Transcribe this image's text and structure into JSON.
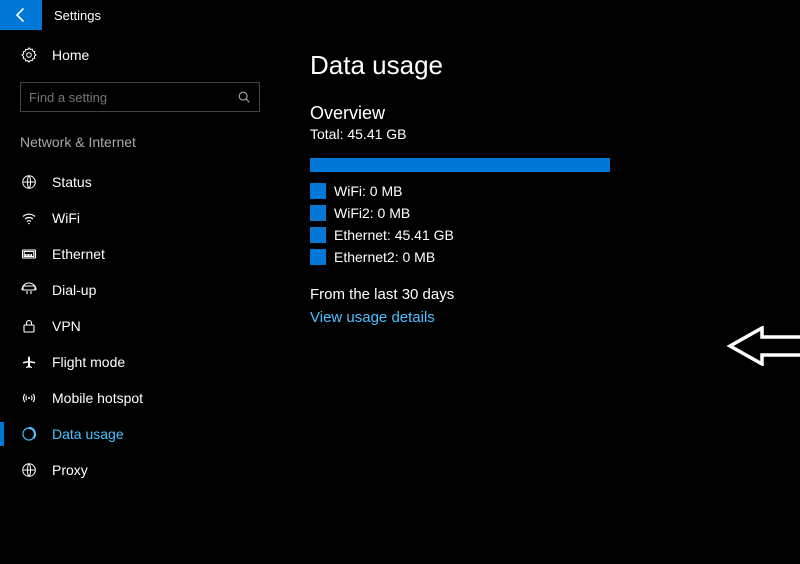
{
  "titlebar": {
    "label": "Settings"
  },
  "sidebar": {
    "home_label": "Home",
    "search_placeholder": "Find a setting",
    "category": "Network & Internet",
    "items": [
      {
        "label": "Status"
      },
      {
        "label": "WiFi"
      },
      {
        "label": "Ethernet"
      },
      {
        "label": "Dial-up"
      },
      {
        "label": "VPN"
      },
      {
        "label": "Flight mode"
      },
      {
        "label": "Mobile hotspot"
      },
      {
        "label": "Data usage"
      },
      {
        "label": "Proxy"
      }
    ]
  },
  "main": {
    "title": "Data usage",
    "overview_heading": "Overview",
    "overview_total": "Total: 45.41 GB",
    "legend": [
      {
        "label": "WiFi: 0 MB"
      },
      {
        "label": "WiFi2: 0 MB"
      },
      {
        "label": "Ethernet: 45.41 GB"
      },
      {
        "label": "Ethernet2: 0 MB"
      }
    ],
    "period": "From the last 30 days",
    "details_link": "View usage details"
  },
  "colors": {
    "accent": "#0078d7",
    "link": "#4cc2ff"
  }
}
